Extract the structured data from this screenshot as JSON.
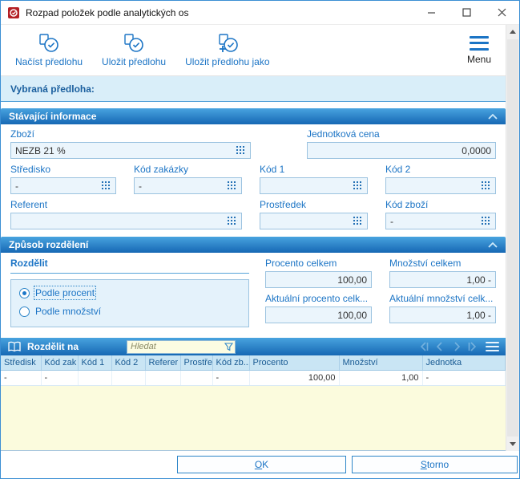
{
  "colors": {
    "accent_blue": "#1B74C5",
    "section_header_top": "#48A3DF",
    "section_header_bottom": "#1668B4",
    "band_blue": "#D9EEF9",
    "field_bg": "#EBF5FC",
    "grid_empty_yellow": "#FBFBDD",
    "search_bg": "#FCFCE2"
  },
  "window": {
    "title": "Rozpad položek podle analytických os"
  },
  "toolbar": {
    "buttons": [
      {
        "label": "Načíst předlohu"
      },
      {
        "label": "Uložit předlohu"
      },
      {
        "label": "Uložit předlohu jako"
      }
    ],
    "menu_label": "Menu"
  },
  "template_band": {
    "label": "Vybraná předloha:"
  },
  "sections": {
    "current_info": {
      "title": "Stávající informace",
      "zbozi_label": "Zboží",
      "zbozi_value": "NEZB 21 %",
      "unit_price_label": "Jednotková cena",
      "unit_price_value": "0,0000",
      "stredisko_label": "Středisko",
      "stredisko_value": "-",
      "kod_zakazky_label": "Kód zakázky",
      "kod_zakazky_value": "-",
      "kod1_label": "Kód 1",
      "kod1_value": "",
      "kod2_label": "Kód 2",
      "kod2_value": "",
      "referent_label": "Referent",
      "referent_value": "",
      "prostredek_label": "Prostředek",
      "prostredek_value": "",
      "kod_zbozi_label": "Kód zboží",
      "kod_zbozi_value": "-"
    },
    "distribution": {
      "title": "Způsob rozdělení",
      "rozdelit_label": "Rozdělit",
      "radio_percent_label": "Podle procent",
      "radio_quantity_label": "Podle množství",
      "selected_radio": "percent",
      "procento_celkem_label": "Procento celkem",
      "procento_celkem_value": "100,00",
      "mnozstvi_celkem_label": "Množství celkem",
      "mnozstvi_celkem_value": "1,00 -",
      "aktualni_procento_label": "Aktuální procento celk...",
      "aktualni_procento_value": "100,00",
      "aktualni_mnozstvi_label": "Aktuální množství celk...",
      "aktualni_mnozstvi_value": "1,00 -"
    },
    "split_grid": {
      "title": "Rozdělit na",
      "search_placeholder": "Hledat",
      "columns": [
        "Středisk",
        "Kód zak",
        "Kód 1",
        "Kód 2",
        "Referer",
        "Prostře",
        "Kód zb...",
        "Procento",
        "Množství",
        "Jednotka"
      ],
      "rows": [
        [
          "-",
          "-",
          "",
          "",
          "",
          "",
          "-",
          "100,00",
          "1,00",
          "-"
        ]
      ]
    }
  },
  "footer": {
    "ok_label": "OK",
    "storno_label": "Storno"
  }
}
